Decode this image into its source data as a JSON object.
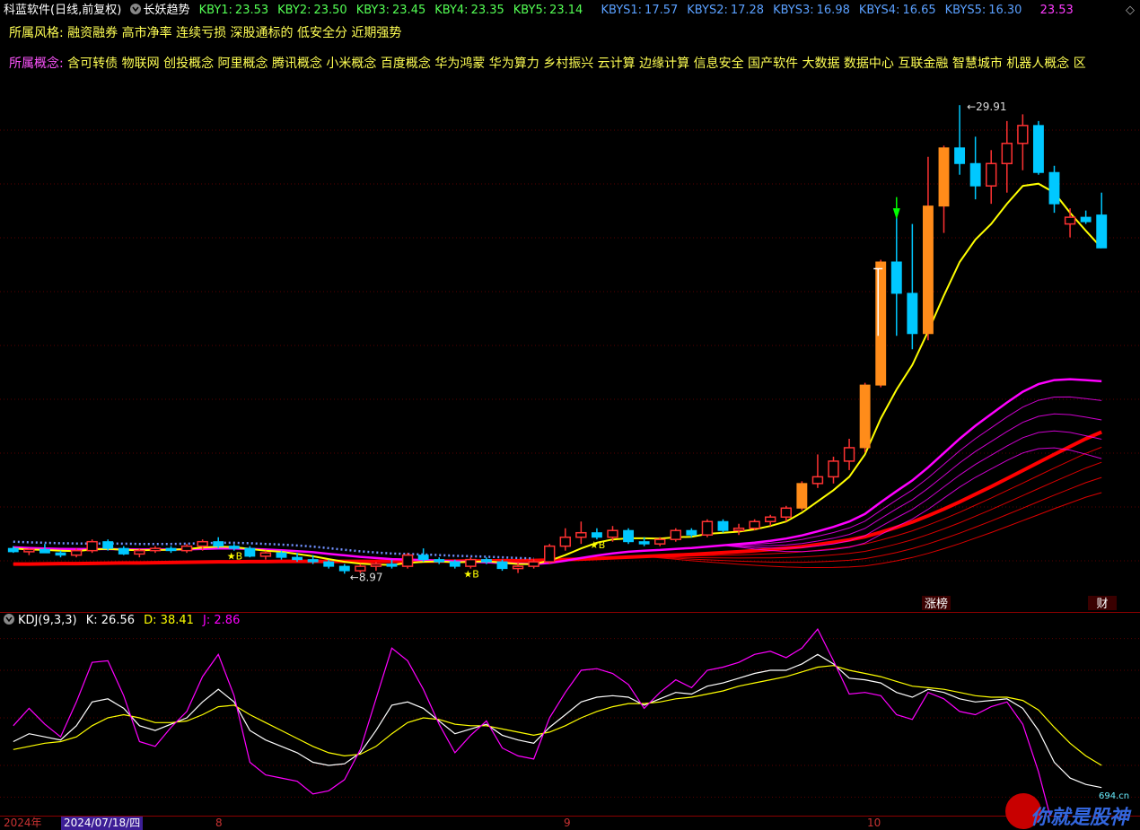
{
  "header": {
    "app": "科蓝软件",
    "mode": "(日线,前复权)",
    "indicator": "长妖趋势",
    "kby": [
      {
        "label": "KBY1:",
        "value": "23.53"
      },
      {
        "label": "KBY2:",
        "value": "23.50"
      },
      {
        "label": "KBY3:",
        "value": "23.45"
      },
      {
        "label": "KBY4:",
        "value": "23.35"
      },
      {
        "label": "KBY5:",
        "value": "23.14"
      }
    ],
    "kbys": [
      {
        "label": "KBYS1:",
        "value": "17.57"
      },
      {
        "label": "KBYS2:",
        "value": "17.28"
      },
      {
        "label": "KBYS3:",
        "value": "16.98"
      },
      {
        "label": "KBYS4:",
        "value": "16.65"
      },
      {
        "label": "KBYS5:",
        "value": "16.30"
      }
    ],
    "last_value": "23.53"
  },
  "style_line": {
    "label": "所属风格:",
    "items": "融资融券 高市净率 连续亏损 深股通标的 低安全分 近期强势"
  },
  "concept_line": {
    "label": "所属概念:",
    "items": "含可转债 物联网 创投概念 阿里概念 腾讯概念 小米概念 百度概念 华为鸿蒙 华为算力 乡村振兴 云计算 边缘计算 信息安全 国产软件 大数据 数据中心 互联金融 智慧城市 机器人概念 区"
  },
  "annotations": {
    "high": "29.91",
    "low": "8.97",
    "marker_a": "涨榜",
    "marker_b": "财",
    "star_label": "★B"
  },
  "kdj": {
    "title": "KDJ(9,3,3)",
    "k_label": "K:",
    "k": "26.56",
    "d_label": "D:",
    "d": "38.41",
    "j_label": "J:",
    "j": "2.86"
  },
  "xaxis": {
    "year": "2024年",
    "date": "2024/07/18/四",
    "m8": "8",
    "m9": "9",
    "m10": "10"
  },
  "watermark": {
    "text": "你就是股神",
    "site": "694.cn"
  },
  "colors": {
    "up": "#ff3232",
    "down_fill": "#00c8ff",
    "limit_up": "#ff8c1a",
    "ma_fast": "#ffff00",
    "ma_mid": "#ff00ff",
    "ma_slow": "#ff0000",
    "k": "#ffffff",
    "d": "#ffff00",
    "j": "#ff00ff",
    "border": "#8b0000"
  },
  "chart_data": [
    {
      "type": "candlestick",
      "title": "长妖趋势",
      "ylim": [
        7.5,
        31
      ],
      "low": 8.97,
      "high": 29.91,
      "candles": [
        [
          10.1,
          10.2,
          9.9,
          9.95
        ],
        [
          9.95,
          10.1,
          9.8,
          10.05
        ],
        [
          10.05,
          10.3,
          9.9,
          9.9
        ],
        [
          9.9,
          10.0,
          9.7,
          9.8
        ],
        [
          9.8,
          10.1,
          9.7,
          10.0
        ],
        [
          10.0,
          10.5,
          9.9,
          10.4
        ],
        [
          10.4,
          10.5,
          10.0,
          10.1
        ],
        [
          10.1,
          10.2,
          9.8,
          9.85
        ],
        [
          9.85,
          10.1,
          9.7,
          10.0
        ],
        [
          10.0,
          10.2,
          9.9,
          10.1
        ],
        [
          10.1,
          10.2,
          9.9,
          10.0
        ],
        [
          10.0,
          10.3,
          9.9,
          10.2
        ],
        [
          10.2,
          10.5,
          10.0,
          10.4
        ],
        [
          10.4,
          10.6,
          10.1,
          10.2
        ],
        [
          10.2,
          10.3,
          10.0,
          10.1
        ],
        [
          10.1,
          10.2,
          9.7,
          9.75
        ],
        [
          9.75,
          10.0,
          9.6,
          9.9
        ],
        [
          9.9,
          10.0,
          9.6,
          9.7
        ],
        [
          9.7,
          9.9,
          9.5,
          9.6
        ],
        [
          9.6,
          9.8,
          9.4,
          9.5
        ],
        [
          9.5,
          9.6,
          9.2,
          9.3
        ],
        [
          9.3,
          9.4,
          8.97,
          9.1
        ],
        [
          9.1,
          9.4,
          9.0,
          9.3
        ],
        [
          9.3,
          9.5,
          9.1,
          9.4
        ],
        [
          9.4,
          9.6,
          9.2,
          9.3
        ],
        [
          9.3,
          9.9,
          9.2,
          9.8
        ],
        [
          9.8,
          10.1,
          9.5,
          9.6
        ],
        [
          9.6,
          9.7,
          9.4,
          9.5
        ],
        [
          9.5,
          9.6,
          9.2,
          9.3
        ],
        [
          9.3,
          9.7,
          9.2,
          9.6
        ],
        [
          9.6,
          9.7,
          9.4,
          9.5
        ],
        [
          9.5,
          9.6,
          9.1,
          9.2
        ],
        [
          9.2,
          9.5,
          9.0,
          9.3
        ],
        [
          9.3,
          9.6,
          9.2,
          9.5
        ],
        [
          9.5,
          10.3,
          9.4,
          10.2
        ],
        [
          10.2,
          11.0,
          10.0,
          10.6
        ],
        [
          10.6,
          11.3,
          10.3,
          10.8
        ],
        [
          10.8,
          11.0,
          10.5,
          10.6
        ],
        [
          10.6,
          11.1,
          10.4,
          10.9
        ],
        [
          10.9,
          11.0,
          10.3,
          10.4
        ],
        [
          10.4,
          10.6,
          10.2,
          10.3
        ],
        [
          10.3,
          10.6,
          10.2,
          10.5
        ],
        [
          10.5,
          11.0,
          10.4,
          10.9
        ],
        [
          10.9,
          11.0,
          10.6,
          10.7
        ],
        [
          10.7,
          11.4,
          10.6,
          11.3
        ],
        [
          11.3,
          11.4,
          10.8,
          10.9
        ],
        [
          10.9,
          11.2,
          10.7,
          11.0
        ],
        [
          11.0,
          11.4,
          10.9,
          11.3
        ],
        [
          11.3,
          11.6,
          11.1,
          11.5
        ],
        [
          11.5,
          12.0,
          11.3,
          11.9
        ],
        [
          11.9,
          13.1,
          11.8,
          13.0
        ],
        [
          13.0,
          14.3,
          12.8,
          13.3
        ],
        [
          13.3,
          14.2,
          13.0,
          14.0
        ],
        [
          14.0,
          15.0,
          13.6,
          14.6
        ],
        [
          14.6,
          17.5,
          14.4,
          17.4
        ],
        [
          17.4,
          23.0,
          17.3,
          22.9
        ],
        [
          22.9,
          24.9,
          19.6,
          21.5
        ],
        [
          21.5,
          24.6,
          19.0,
          19.7
        ],
        [
          19.7,
          27.6,
          19.4,
          25.4
        ],
        [
          25.4,
          28.1,
          24.2,
          28.0
        ],
        [
          28.0,
          29.91,
          26.8,
          27.3
        ],
        [
          27.3,
          28.5,
          25.7,
          26.3
        ],
        [
          26.3,
          27.9,
          25.5,
          27.3
        ],
        [
          27.3,
          29.2,
          26.0,
          28.2
        ],
        [
          28.2,
          29.5,
          27.0,
          29.0
        ],
        [
          29.0,
          29.2,
          26.8,
          26.9
        ],
        [
          26.9,
          27.2,
          25.1,
          25.5
        ],
        [
          24.6,
          25.3,
          24.0,
          24.9
        ],
        [
          24.9,
          25.2,
          24.6,
          24.7
        ],
        [
          25.0,
          26.0,
          23.7,
          23.53
        ]
      ],
      "mas": [
        {
          "name": "KBY1",
          "color": "#ffff00",
          "values": [
            10.1,
            10.05,
            10.03,
            10.0,
            9.98,
            10.05,
            10.08,
            10.04,
            10.02,
            10.03,
            10.04,
            10.07,
            10.14,
            10.18,
            10.16,
            10.08,
            10.0,
            9.95,
            9.85,
            9.75,
            9.62,
            9.5,
            9.42,
            9.38,
            9.36,
            9.45,
            9.5,
            9.52,
            9.48,
            9.5,
            9.52,
            9.47,
            9.4,
            9.4,
            9.55,
            9.8,
            10.1,
            10.35,
            10.5,
            10.55,
            10.55,
            10.54,
            10.6,
            10.62,
            10.75,
            10.8,
            10.85,
            10.95,
            11.1,
            11.3,
            11.7,
            12.2,
            12.7,
            13.3,
            14.3,
            15.9,
            17.2,
            18.3,
            19.8,
            21.4,
            22.9,
            23.9,
            24.6,
            25.5,
            26.3,
            26.4,
            26.0,
            25.1,
            24.3,
            23.53
          ]
        },
        {
          "name": "KBYS1",
          "color": "#ff00ff",
          "values": [
            10.15,
            10.12,
            10.1,
            10.08,
            10.07,
            10.07,
            10.07,
            10.06,
            10.05,
            10.05,
            10.05,
            10.06,
            10.08,
            10.1,
            10.1,
            10.08,
            10.05,
            10.02,
            9.98,
            9.93,
            9.86,
            9.79,
            9.72,
            9.67,
            9.62,
            9.6,
            9.58,
            9.55,
            9.52,
            9.5,
            9.48,
            9.45,
            9.42,
            9.4,
            9.45,
            9.55,
            9.67,
            9.78,
            9.88,
            9.95,
            10.0,
            10.03,
            10.08,
            10.12,
            10.18,
            10.24,
            10.3,
            10.36,
            10.44,
            10.54,
            10.68,
            10.86,
            11.06,
            11.3,
            11.64,
            12.16,
            12.66,
            13.14,
            13.72,
            14.36,
            15.0,
            15.58,
            16.1,
            16.62,
            17.1,
            17.44,
            17.62,
            17.66,
            17.62,
            17.57
          ]
        },
        {
          "name": "KBYS5",
          "color": "#ff0000",
          "values": [
            9.4,
            9.4,
            9.41,
            9.42,
            9.42,
            9.43,
            9.44,
            9.45,
            9.45,
            9.46,
            9.47,
            9.48,
            9.49,
            9.5,
            9.5,
            9.51,
            9.51,
            9.52,
            9.52,
            9.52,
            9.52,
            9.52,
            9.52,
            9.52,
            9.52,
            9.52,
            9.53,
            9.53,
            9.53,
            9.54,
            9.54,
            9.55,
            9.55,
            9.56,
            9.58,
            9.6,
            9.62,
            9.65,
            9.68,
            9.71,
            9.74,
            9.77,
            9.8,
            9.83,
            9.87,
            9.91,
            9.95,
            10.0,
            10.05,
            10.11,
            10.18,
            10.27,
            10.37,
            10.48,
            10.62,
            10.82,
            11.04,
            11.28,
            11.56,
            11.86,
            12.18,
            12.52,
            12.86,
            13.22,
            13.58,
            13.94,
            14.3,
            14.65,
            15.0,
            15.3
          ]
        }
      ]
    },
    {
      "type": "line",
      "title": "KDJ(9,3,3)",
      "ylim": [
        -10,
        110
      ],
      "series": [
        {
          "name": "K",
          "color": "#ffffff",
          "values": [
            35,
            40,
            38,
            36,
            45,
            60,
            62,
            56,
            45,
            42,
            46,
            50,
            60,
            68,
            60,
            42,
            36,
            32,
            28,
            22,
            20,
            21,
            28,
            42,
            58,
            60,
            56,
            48,
            40,
            43,
            46,
            39,
            36,
            34,
            44,
            52,
            60,
            63,
            64,
            63,
            58,
            62,
            66,
            65,
            70,
            72,
            75,
            78,
            80,
            80,
            84,
            90,
            84,
            75,
            74,
            72,
            66,
            63,
            68,
            66,
            62,
            60,
            61,
            62,
            56,
            42,
            22,
            12,
            8,
            6
          ]
        },
        {
          "name": "D",
          "color": "#ffff00",
          "values": [
            30,
            32,
            34,
            35,
            38,
            45,
            50,
            52,
            50,
            47,
            47,
            48,
            52,
            57,
            58,
            52,
            47,
            42,
            37,
            32,
            28,
            26,
            27,
            32,
            40,
            47,
            50,
            49,
            46,
            45,
            45,
            43,
            41,
            39,
            41,
            45,
            50,
            54,
            57,
            59,
            59,
            60,
            62,
            63,
            65,
            67,
            70,
            72,
            74,
            76,
            79,
            82,
            83,
            80,
            78,
            76,
            73,
            70,
            69,
            68,
            66,
            64,
            63,
            63,
            61,
            55,
            44,
            34,
            26,
            20
          ]
        },
        {
          "name": "J",
          "color": "#ff00ff",
          "values": [
            45,
            56,
            46,
            38,
            60,
            85,
            86,
            64,
            35,
            32,
            44,
            54,
            76,
            90,
            64,
            22,
            14,
            12,
            10,
            2,
            4,
            11,
            30,
            62,
            94,
            86,
            68,
            46,
            28,
            39,
            48,
            31,
            26,
            24,
            50,
            66,
            80,
            81,
            78,
            71,
            56,
            66,
            74,
            69,
            80,
            82,
            85,
            90,
            92,
            88,
            94,
            106,
            86,
            65,
            66,
            64,
            52,
            49,
            66,
            62,
            54,
            52,
            57,
            60,
            46,
            16,
            -22,
            -32,
            -28,
            -22
          ]
        }
      ]
    }
  ]
}
